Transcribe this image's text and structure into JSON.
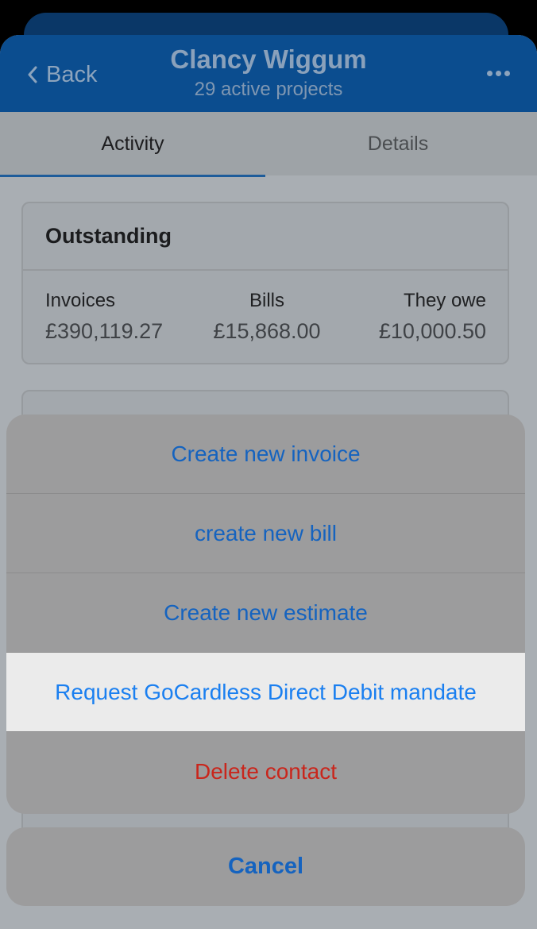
{
  "header": {
    "back_label": "Back",
    "title": "Clancy Wiggum",
    "subtitle": "29 active projects",
    "more_icon": "ellipsis-icon"
  },
  "tabs": [
    {
      "label": "Activity",
      "active": true
    },
    {
      "label": "Details",
      "active": false
    }
  ],
  "outstanding": {
    "title": "Outstanding",
    "columns": [
      {
        "label": "Invoices",
        "amount": "£390,119.27"
      },
      {
        "label": "Bills",
        "amount": "£15,868.00"
      },
      {
        "label": "They owe",
        "amount": "£10,000.50"
      }
    ]
  },
  "action_sheet": {
    "actions": [
      {
        "label": "Create new invoice"
      },
      {
        "label": "create new bill"
      },
      {
        "label": "Create new estimate"
      },
      {
        "label": "Request GoCardless Direct Debit mandate",
        "highlighted": true
      },
      {
        "label": "Delete contact",
        "destructive": true
      }
    ],
    "cancel_label": "Cancel"
  },
  "colors": {
    "nav_bar": "#0b4d8f",
    "action_text": "#1563bf",
    "destructive_text": "#c9261c"
  }
}
